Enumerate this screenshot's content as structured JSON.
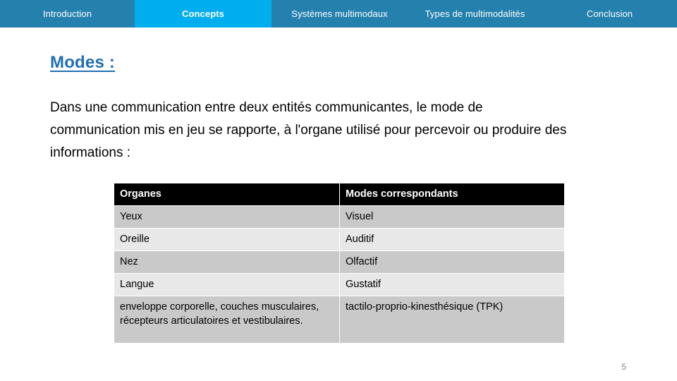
{
  "navbar": {
    "items": [
      {
        "label": "Introduction",
        "active": false
      },
      {
        "label": "Concepts",
        "active": true
      },
      {
        "label": "Systèmes multimodaux",
        "active": false
      },
      {
        "label": "Types de multimodalités",
        "active": false
      },
      {
        "label": "Conclusion",
        "active": false
      }
    ],
    "background_color": "#2481AE",
    "active_color": "#00AEEF",
    "text_color": "#FFFFFF"
  },
  "slide": {
    "title": "Modes :",
    "title_color": "#1F6FB4",
    "paragraph": "Dans une communication entre deux entités communicantes, le mode de communication mis en jeu se rapporte, à l'organe utilisé pour percevoir ou produire des informations :",
    "page_number": "5"
  },
  "table": {
    "header": [
      "Organes",
      "Modes correspondants"
    ],
    "header_background": "#000000",
    "header_text_color": "#FFFFFF",
    "row_color_dark": "#C9C9C9",
    "row_color_light": "#E8E8E8",
    "rows": [
      {
        "organe": "Yeux",
        "mode": "Visuel"
      },
      {
        "organe": "Oreille",
        "mode": "Auditif"
      },
      {
        "organe": "Nez",
        "mode": "Olfactif"
      },
      {
        "organe": "Langue",
        "mode": "Gustatif"
      },
      {
        "organe": "enveloppe corporelle, couches musculaires, récepteurs articulatoires et vestibulaires.",
        "mode": "tactilo-proprio-kinesthésique (TPK)"
      }
    ]
  }
}
